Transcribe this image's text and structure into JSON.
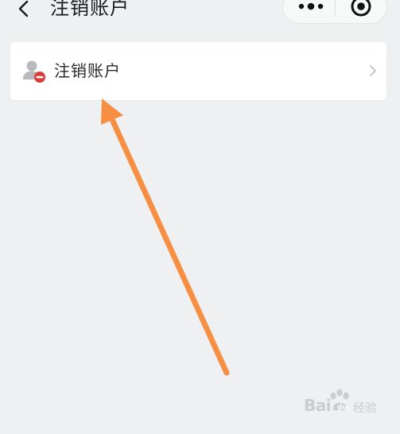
{
  "nav": {
    "title": "注销账户",
    "back_icon": "chevron-left-icon",
    "more_icon": "more-dots-icon",
    "close_icon": "target-close-icon"
  },
  "card": {
    "label": "注销账户",
    "icon": "user-remove-icon",
    "chevron_icon": "chevron-right-icon"
  },
  "annotation": {
    "arrow_color": "#f68f44"
  },
  "watermark": {
    "brand": "Bai",
    "brand_suffix": "经验"
  },
  "colors": {
    "background": "#eef0f1",
    "card": "#ffffff",
    "remove_badge": "#d93a35"
  }
}
